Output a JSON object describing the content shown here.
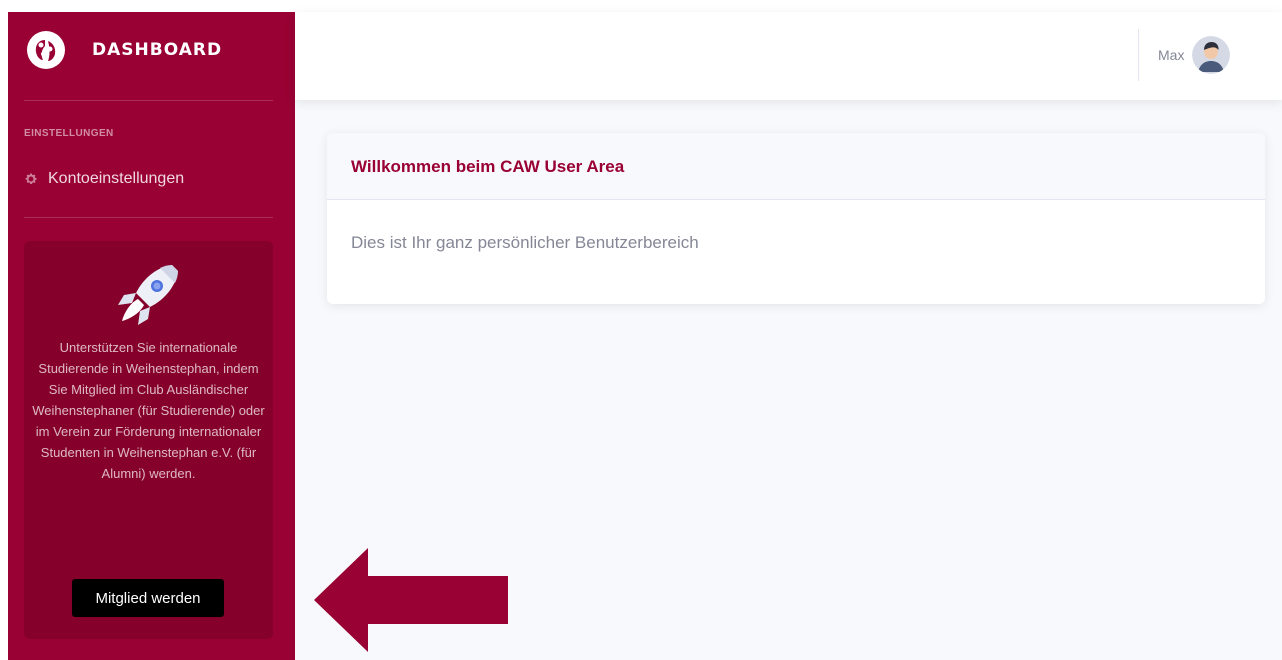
{
  "sidebar": {
    "brand": "DASHBOARD",
    "section_heading": "EINSTELLUNGEN",
    "nav_items": [
      {
        "label": "Kontoeinstellungen",
        "icon": "gear-icon"
      }
    ],
    "promo": {
      "icon": "rocket-icon",
      "text": "Unterstützen Sie internationale Studierende in Weihenstephan, indem Sie Mitglied im Club Ausländischer Weihenstephaner (für Studierende) oder im Verein zur Förderung internationaler Studenten in Weihenstephan e.V. (für Alumni) werden.",
      "button_label": "Mitglied werden"
    }
  },
  "topbar": {
    "user_name": "Max",
    "avatar_icon": "user-avatar"
  },
  "card": {
    "title": "Willkommen beim CAW User Area",
    "body": "Dies ist Ihr ganz persönlicher Benutzerbereich"
  },
  "colors": {
    "sidebar": "#990033",
    "promo_bg": "#85002a",
    "accent": "#990033",
    "arrow": "#990033",
    "page_bg": "#f8f9fc"
  },
  "annotation": {
    "arrow_icon": "left-arrow-icon"
  }
}
